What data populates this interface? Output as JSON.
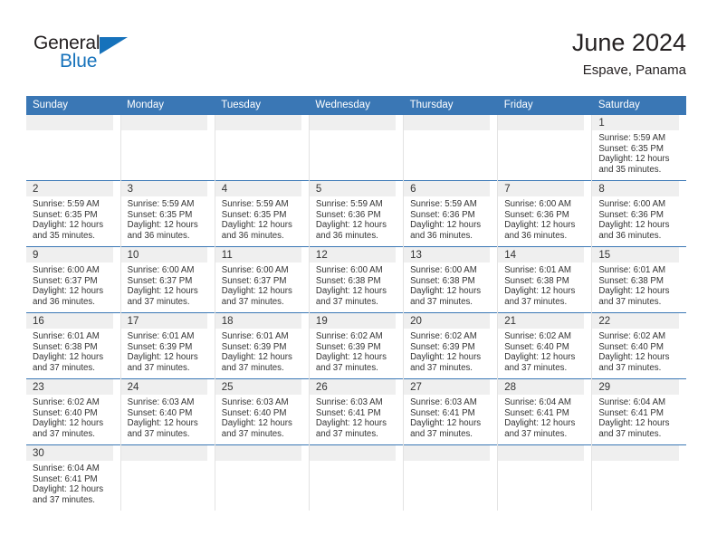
{
  "brand": {
    "name_primary": "General",
    "name_secondary": "Blue",
    "triangle_icon": "blue-triangle-logo-mark",
    "color_primary": "#231f20",
    "color_secondary": "#1672bb"
  },
  "header": {
    "month_title": "June 2024",
    "location": "Espave, Panama"
  },
  "theme": {
    "header_blue": "#3a77b5",
    "day_band_gray": "#efefef",
    "text": "#333333"
  },
  "calendar": {
    "weekdays": [
      "Sunday",
      "Monday",
      "Tuesday",
      "Wednesday",
      "Thursday",
      "Friday",
      "Saturday"
    ],
    "weeks": [
      [
        {
          "day": "",
          "sunrise": "",
          "sunset": "",
          "daylight_line1": "",
          "daylight_line2": "",
          "empty": true
        },
        {
          "day": "",
          "sunrise": "",
          "sunset": "",
          "daylight_line1": "",
          "daylight_line2": "",
          "empty": true
        },
        {
          "day": "",
          "sunrise": "",
          "sunset": "",
          "daylight_line1": "",
          "daylight_line2": "",
          "empty": true
        },
        {
          "day": "",
          "sunrise": "",
          "sunset": "",
          "daylight_line1": "",
          "daylight_line2": "",
          "empty": true
        },
        {
          "day": "",
          "sunrise": "",
          "sunset": "",
          "daylight_line1": "",
          "daylight_line2": "",
          "empty": true
        },
        {
          "day": "",
          "sunrise": "",
          "sunset": "",
          "daylight_line1": "",
          "daylight_line2": "",
          "empty": true
        },
        {
          "day": "1",
          "sunrise": "Sunrise: 5:59 AM",
          "sunset": "Sunset: 6:35 PM",
          "daylight_line1": "Daylight: 12 hours",
          "daylight_line2": "and 35 minutes.",
          "empty": false
        }
      ],
      [
        {
          "day": "2",
          "sunrise": "Sunrise: 5:59 AM",
          "sunset": "Sunset: 6:35 PM",
          "daylight_line1": "Daylight: 12 hours",
          "daylight_line2": "and 35 minutes.",
          "empty": false
        },
        {
          "day": "3",
          "sunrise": "Sunrise: 5:59 AM",
          "sunset": "Sunset: 6:35 PM",
          "daylight_line1": "Daylight: 12 hours",
          "daylight_line2": "and 36 minutes.",
          "empty": false
        },
        {
          "day": "4",
          "sunrise": "Sunrise: 5:59 AM",
          "sunset": "Sunset: 6:35 PM",
          "daylight_line1": "Daylight: 12 hours",
          "daylight_line2": "and 36 minutes.",
          "empty": false
        },
        {
          "day": "5",
          "sunrise": "Sunrise: 5:59 AM",
          "sunset": "Sunset: 6:36 PM",
          "daylight_line1": "Daylight: 12 hours",
          "daylight_line2": "and 36 minutes.",
          "empty": false
        },
        {
          "day": "6",
          "sunrise": "Sunrise: 5:59 AM",
          "sunset": "Sunset: 6:36 PM",
          "daylight_line1": "Daylight: 12 hours",
          "daylight_line2": "and 36 minutes.",
          "empty": false
        },
        {
          "day": "7",
          "sunrise": "Sunrise: 6:00 AM",
          "sunset": "Sunset: 6:36 PM",
          "daylight_line1": "Daylight: 12 hours",
          "daylight_line2": "and 36 minutes.",
          "empty": false
        },
        {
          "day": "8",
          "sunrise": "Sunrise: 6:00 AM",
          "sunset": "Sunset: 6:36 PM",
          "daylight_line1": "Daylight: 12 hours",
          "daylight_line2": "and 36 minutes.",
          "empty": false
        }
      ],
      [
        {
          "day": "9",
          "sunrise": "Sunrise: 6:00 AM",
          "sunset": "Sunset: 6:37 PM",
          "daylight_line1": "Daylight: 12 hours",
          "daylight_line2": "and 36 minutes.",
          "empty": false
        },
        {
          "day": "10",
          "sunrise": "Sunrise: 6:00 AM",
          "sunset": "Sunset: 6:37 PM",
          "daylight_line1": "Daylight: 12 hours",
          "daylight_line2": "and 37 minutes.",
          "empty": false
        },
        {
          "day": "11",
          "sunrise": "Sunrise: 6:00 AM",
          "sunset": "Sunset: 6:37 PM",
          "daylight_line1": "Daylight: 12 hours",
          "daylight_line2": "and 37 minutes.",
          "empty": false
        },
        {
          "day": "12",
          "sunrise": "Sunrise: 6:00 AM",
          "sunset": "Sunset: 6:38 PM",
          "daylight_line1": "Daylight: 12 hours",
          "daylight_line2": "and 37 minutes.",
          "empty": false
        },
        {
          "day": "13",
          "sunrise": "Sunrise: 6:00 AM",
          "sunset": "Sunset: 6:38 PM",
          "daylight_line1": "Daylight: 12 hours",
          "daylight_line2": "and 37 minutes.",
          "empty": false
        },
        {
          "day": "14",
          "sunrise": "Sunrise: 6:01 AM",
          "sunset": "Sunset: 6:38 PM",
          "daylight_line1": "Daylight: 12 hours",
          "daylight_line2": "and 37 minutes.",
          "empty": false
        },
        {
          "day": "15",
          "sunrise": "Sunrise: 6:01 AM",
          "sunset": "Sunset: 6:38 PM",
          "daylight_line1": "Daylight: 12 hours",
          "daylight_line2": "and 37 minutes.",
          "empty": false
        }
      ],
      [
        {
          "day": "16",
          "sunrise": "Sunrise: 6:01 AM",
          "sunset": "Sunset: 6:38 PM",
          "daylight_line1": "Daylight: 12 hours",
          "daylight_line2": "and 37 minutes.",
          "empty": false
        },
        {
          "day": "17",
          "sunrise": "Sunrise: 6:01 AM",
          "sunset": "Sunset: 6:39 PM",
          "daylight_line1": "Daylight: 12 hours",
          "daylight_line2": "and 37 minutes.",
          "empty": false
        },
        {
          "day": "18",
          "sunrise": "Sunrise: 6:01 AM",
          "sunset": "Sunset: 6:39 PM",
          "daylight_line1": "Daylight: 12 hours",
          "daylight_line2": "and 37 minutes.",
          "empty": false
        },
        {
          "day": "19",
          "sunrise": "Sunrise: 6:02 AM",
          "sunset": "Sunset: 6:39 PM",
          "daylight_line1": "Daylight: 12 hours",
          "daylight_line2": "and 37 minutes.",
          "empty": false
        },
        {
          "day": "20",
          "sunrise": "Sunrise: 6:02 AM",
          "sunset": "Sunset: 6:39 PM",
          "daylight_line1": "Daylight: 12 hours",
          "daylight_line2": "and 37 minutes.",
          "empty": false
        },
        {
          "day": "21",
          "sunrise": "Sunrise: 6:02 AM",
          "sunset": "Sunset: 6:40 PM",
          "daylight_line1": "Daylight: 12 hours",
          "daylight_line2": "and 37 minutes.",
          "empty": false
        },
        {
          "day": "22",
          "sunrise": "Sunrise: 6:02 AM",
          "sunset": "Sunset: 6:40 PM",
          "daylight_line1": "Daylight: 12 hours",
          "daylight_line2": "and 37 minutes.",
          "empty": false
        }
      ],
      [
        {
          "day": "23",
          "sunrise": "Sunrise: 6:02 AM",
          "sunset": "Sunset: 6:40 PM",
          "daylight_line1": "Daylight: 12 hours",
          "daylight_line2": "and 37 minutes.",
          "empty": false
        },
        {
          "day": "24",
          "sunrise": "Sunrise: 6:03 AM",
          "sunset": "Sunset: 6:40 PM",
          "daylight_line1": "Daylight: 12 hours",
          "daylight_line2": "and 37 minutes.",
          "empty": false
        },
        {
          "day": "25",
          "sunrise": "Sunrise: 6:03 AM",
          "sunset": "Sunset: 6:40 PM",
          "daylight_line1": "Daylight: 12 hours",
          "daylight_line2": "and 37 minutes.",
          "empty": false
        },
        {
          "day": "26",
          "sunrise": "Sunrise: 6:03 AM",
          "sunset": "Sunset: 6:41 PM",
          "daylight_line1": "Daylight: 12 hours",
          "daylight_line2": "and 37 minutes.",
          "empty": false
        },
        {
          "day": "27",
          "sunrise": "Sunrise: 6:03 AM",
          "sunset": "Sunset: 6:41 PM",
          "daylight_line1": "Daylight: 12 hours",
          "daylight_line2": "and 37 minutes.",
          "empty": false
        },
        {
          "day": "28",
          "sunrise": "Sunrise: 6:04 AM",
          "sunset": "Sunset: 6:41 PM",
          "daylight_line1": "Daylight: 12 hours",
          "daylight_line2": "and 37 minutes.",
          "empty": false
        },
        {
          "day": "29",
          "sunrise": "Sunrise: 6:04 AM",
          "sunset": "Sunset: 6:41 PM",
          "daylight_line1": "Daylight: 12 hours",
          "daylight_line2": "and 37 minutes.",
          "empty": false
        }
      ],
      [
        {
          "day": "30",
          "sunrise": "Sunrise: 6:04 AM",
          "sunset": "Sunset: 6:41 PM",
          "daylight_line1": "Daylight: 12 hours",
          "daylight_line2": "and 37 minutes.",
          "empty": false
        },
        {
          "day": "",
          "sunrise": "",
          "sunset": "",
          "daylight_line1": "",
          "daylight_line2": "",
          "empty": true
        },
        {
          "day": "",
          "sunrise": "",
          "sunset": "",
          "daylight_line1": "",
          "daylight_line2": "",
          "empty": true
        },
        {
          "day": "",
          "sunrise": "",
          "sunset": "",
          "daylight_line1": "",
          "daylight_line2": "",
          "empty": true
        },
        {
          "day": "",
          "sunrise": "",
          "sunset": "",
          "daylight_line1": "",
          "daylight_line2": "",
          "empty": true
        },
        {
          "day": "",
          "sunrise": "",
          "sunset": "",
          "daylight_line1": "",
          "daylight_line2": "",
          "empty": true
        },
        {
          "day": "",
          "sunrise": "",
          "sunset": "",
          "daylight_line1": "",
          "daylight_line2": "",
          "empty": true
        }
      ]
    ]
  }
}
